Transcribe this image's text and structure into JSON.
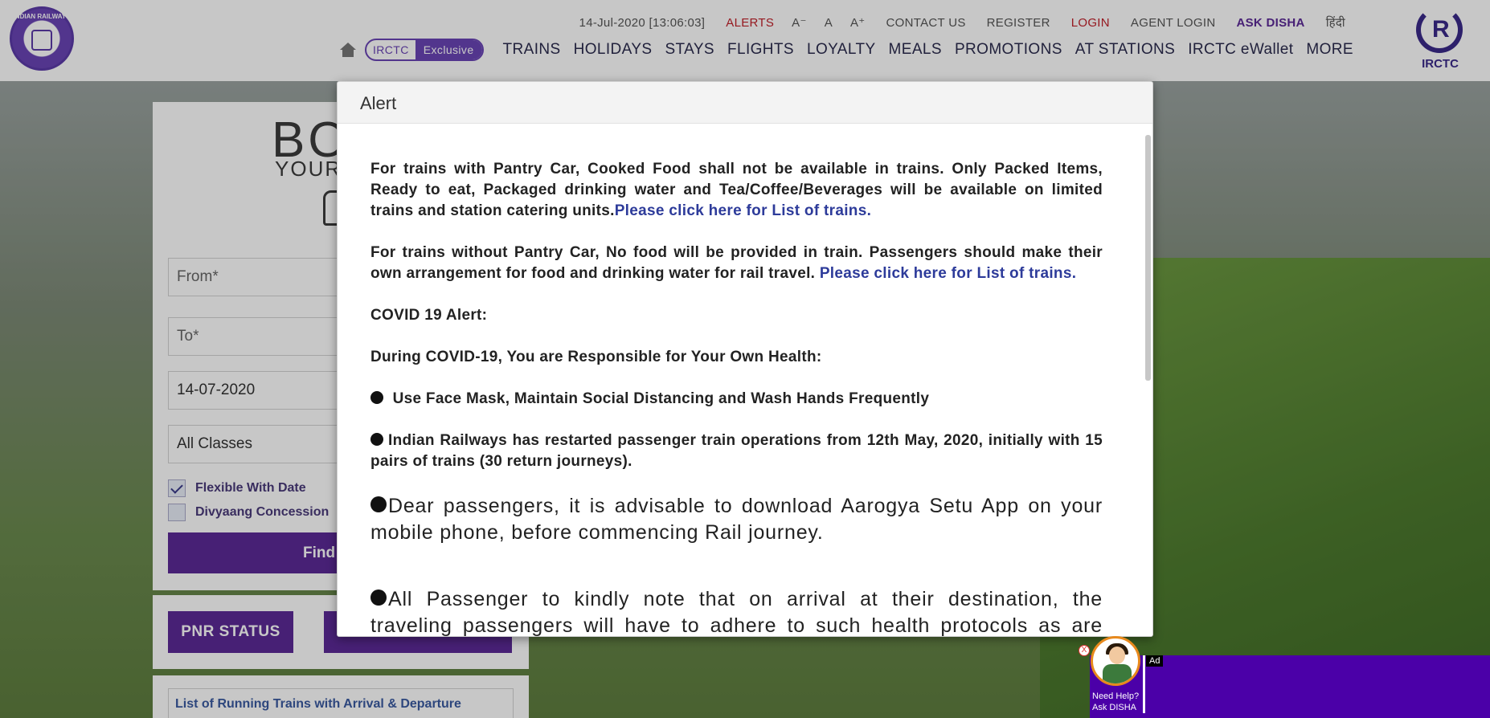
{
  "header": {
    "logo_left_text": "INDIAN RAILWAYS",
    "logo_right_text": "IRCTC",
    "datetime": "14-Jul-2020 [13:06:03]",
    "alerts": "ALERTS",
    "font_small": "A⁻",
    "font_normal": "A",
    "font_large": "A⁺",
    "contact": "CONTACT US",
    "register": "REGISTER",
    "login": "LOGIN",
    "agent_login": "AGENT LOGIN",
    "ask_disha": "ASK DISHA",
    "hindi": "हिंदी"
  },
  "nav": {
    "exclusive_a": "IRCTC",
    "exclusive_b": "Exclusive",
    "items": [
      "TRAINS",
      "HOLIDAYS",
      "STAYS",
      "FLIGHTS",
      "LOYALTY",
      "MEALS",
      "PROMOTIONS",
      "AT STATIONS",
      "IRCTC eWallet",
      "MORE"
    ]
  },
  "booking": {
    "title_partial": "BO",
    "subtitle_partial": "YOUR",
    "from_placeholder": "From*",
    "to_placeholder": "To*",
    "date_value": "14-07-2020",
    "class_value": "All Classes",
    "flexible_label": "Flexible With Date",
    "divyaang_label": "Divyaang Concession",
    "find_label": "Find",
    "pnr_label": "PNR STATUS",
    "running_trains": "List of Running Trains with Arrival & Departure"
  },
  "modal": {
    "title": "Alert",
    "p1_text": "For trains with Pantry Car, Cooked Food shall not be available in trains. Only Packed Items, Ready to eat, Packaged drinking water and Tea/Coffee/Beverages will be available on limited trains and station catering units.",
    "p1_link": "Please click here for List of trains.",
    "p2_text": "For trains without Pantry Car, No food will be provided in train. Passengers should make their own arrangement for food and drinking water for rail travel. ",
    "p2_link": "Please click here for List of trains.",
    "p3": "COVID 19 Alert:",
    "p4": "During COVID-19, You are Responsible for Your Own Health:",
    "p5": " Use Face Mask, Maintain Social Distancing and Wash Hands Frequently",
    "p6": "Indian Railways has restarted passenger train operations from 12th May, 2020, initially with 15 pairs of trains (30 return journeys).",
    "p7": "Dear passengers, it is advisable to download Aarogya Setu App on your mobile phone, before commencing Rail journey.",
    "p8": "All Passenger to kindly note that on arrival at their destination, the traveling passengers will have to adhere to such health protocols as are prescribed by"
  },
  "ad": {
    "tag": "Ad",
    "close": "X",
    "disha_line1": "Need Help?",
    "disha_line2": "Ask DISHA"
  },
  "colors": {
    "brand_purple": "#5b2a97",
    "alert_red": "#c0202a",
    "link_blue": "#2d3b9a"
  }
}
